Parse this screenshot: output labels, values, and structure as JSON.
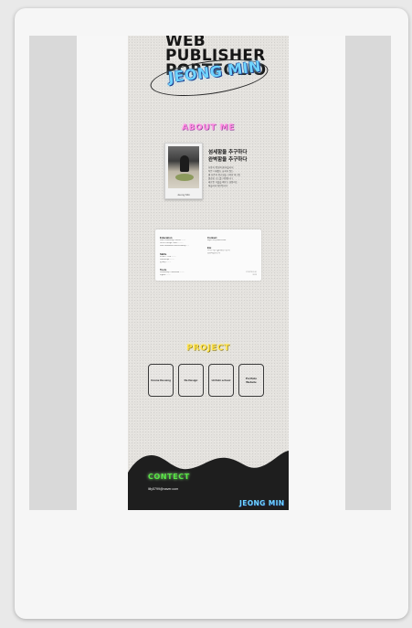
{
  "hero": {
    "title_lines": [
      "WEB",
      "PUBLISHER",
      "PORTFOLIO"
    ],
    "name": "JEONG MIN"
  },
  "about": {
    "title": "ABOUT ME",
    "photo_caption": "Jeong Min",
    "headline_lines": [
      "섬세함을 추구하다",
      "완벽함을 추구하다"
    ],
    "body_lines": [
      "사용자 중심의 웹 퍼블리셔",
      "작은 디테일도 놓치지 않는",
      "웹 표준과 접근성을 고려한 마크업",
      "깔끔한 코드를 지향합니다",
      "새로운 기술을 배우고 성장하는",
      "퍼블리셔 정민입니다"
    ]
  },
  "info": {
    "left": [
      {
        "title": "Education",
        "rows": [
          "Web Publishing Course ........",
          "UI/UX Design Class .........",
          "Web Standard & Accessibility ....."
        ]
      },
      {
        "title": "Skills",
        "rows": [
          "HTML / CSS ........",
          "JavaScript ........",
          "jQuery ........"
        ]
      },
      {
        "title": "Tools",
        "rows": [
          "Photoshop / Illustrator ........",
          "Figma ........"
        ]
      }
    ],
    "right": [
      {
        "title": "Contact",
        "rows": [
          "lilly5799@naver.com"
        ]
      },
      {
        "title": "Etc",
        "rows": [
          "GTQ 1급 / 웹디자인기능사",
          "컴퓨터활용능력"
        ]
      }
    ],
    "footer_lines": [
      "PORTFOLIO",
      "2023"
    ]
  },
  "project": {
    "title": "PROJECT",
    "items": [
      "Creme Dessing",
      "Re Design",
      "Hi Kidz school",
      "Portfolio Website"
    ]
  },
  "contact": {
    "title": "CONTECT",
    "email": "lilly5799@naver.com",
    "footer_name": "JEONG MIN"
  },
  "colors": {
    "about_accent": "#ff8ae2",
    "project_accent": "#ffe24a",
    "contact_accent": "#5de34b",
    "name_accent": "#6fd4ff",
    "wave_fill": "#1e1e1e"
  }
}
